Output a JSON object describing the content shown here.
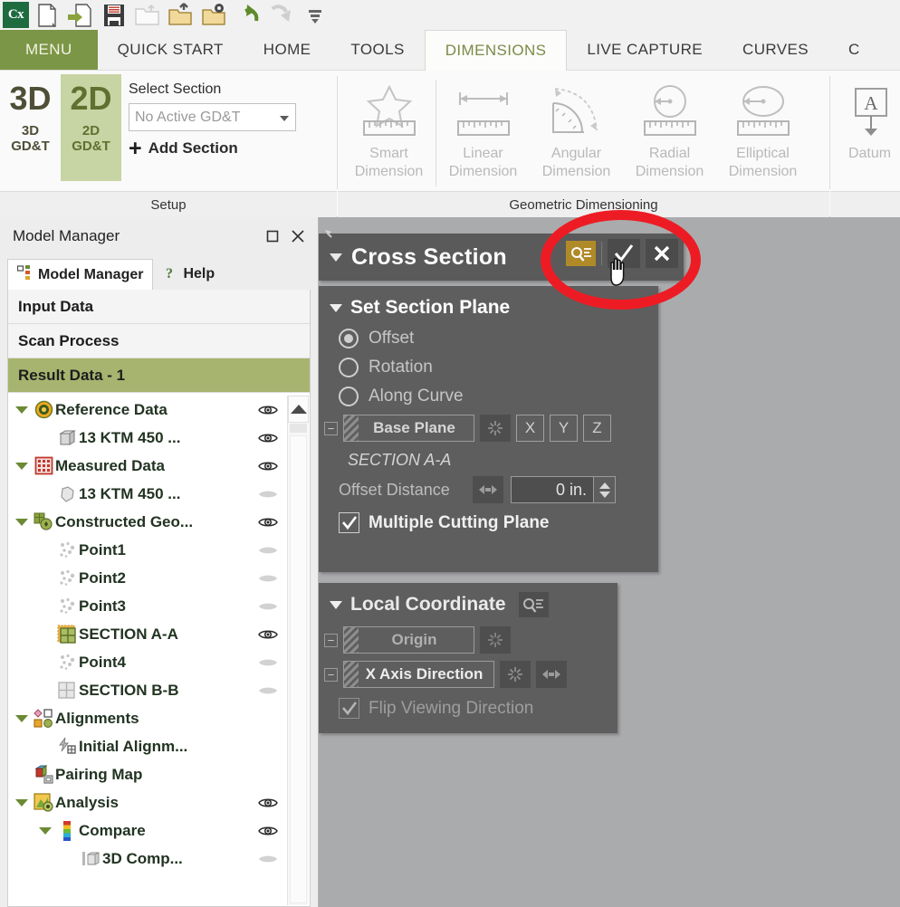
{
  "app": {
    "logo_text": "Cx",
    "quick_access": [
      {
        "name": "new-document-icon",
        "label": "New"
      },
      {
        "name": "import-document-icon",
        "label": "Import"
      },
      {
        "name": "save-icon",
        "label": "Save"
      },
      {
        "name": "open-folder-disabled-icon",
        "label": "Open"
      },
      {
        "name": "open-folder-up-icon",
        "label": "Open Recent"
      },
      {
        "name": "open-folder-settings-icon",
        "label": "Open Settings"
      },
      {
        "name": "undo-icon",
        "label": "Undo"
      },
      {
        "name": "redo-disabled-icon",
        "label": "Redo"
      },
      {
        "name": "customize-toolbar-icon",
        "label": "Customize Quick Access Toolbar"
      }
    ]
  },
  "ribbon": {
    "tabs": [
      {
        "label": "MENU",
        "state": "menu"
      },
      {
        "label": "QUICK START",
        "state": "normal"
      },
      {
        "label": "HOME",
        "state": "normal"
      },
      {
        "label": "TOOLS",
        "state": "normal"
      },
      {
        "label": "DIMENSIONS",
        "state": "active"
      },
      {
        "label": "LIVE CAPTURE",
        "state": "normal"
      },
      {
        "label": "CURVES",
        "state": "normal"
      },
      {
        "label": "C",
        "state": "clipped"
      }
    ],
    "groups": [
      {
        "label": "Setup",
        "big_buttons": [
          {
            "big": "3D",
            "sub_line1": "3D",
            "sub_line2": "GD&T",
            "selected": false
          },
          {
            "big": "2D",
            "sub_line1": "2D",
            "sub_line2": "GD&T",
            "selected": true
          }
        ],
        "select_section_label": "Select Section",
        "select_section_value": "No Active GD&T",
        "add_section_label": "Add Section",
        "add_section_plus": "+"
      },
      {
        "label": "Geometric Dimensioning",
        "buttons": [
          {
            "icon": "smart-dimension-icon",
            "line1": "Smart",
            "line2": "Dimension",
            "disabled": true
          },
          {
            "icon": "linear-dimension-icon",
            "line1": "Linear",
            "line2": "Dimension",
            "disabled": true
          },
          {
            "icon": "angular-dimension-icon",
            "line1": "Angular",
            "line2": "Dimension",
            "disabled": true
          },
          {
            "icon": "radial-dimension-icon",
            "line1": "Radial",
            "line2": "Dimension",
            "disabled": true
          },
          {
            "icon": "elliptical-dimension-icon",
            "line1": "Elliptical",
            "line2": "Dimension",
            "disabled": true
          }
        ]
      },
      {
        "label": "",
        "buttons": [
          {
            "icon": "datum-icon",
            "line1": "Datum",
            "line2": "",
            "disabled": true
          }
        ]
      }
    ]
  },
  "model_manager": {
    "title": "Model Manager",
    "restore_glyph": "□",
    "close_glyph": "✕",
    "tabs": [
      {
        "label": "Model Manager",
        "icon": "tree-icon",
        "active": true
      },
      {
        "label": "Help",
        "icon": "help-icon",
        "active": false
      }
    ],
    "sections": [
      {
        "label": "Input Data",
        "selected": false
      },
      {
        "label": "Scan Process",
        "selected": false
      },
      {
        "label": "Result Data - 1",
        "selected": true
      }
    ],
    "tree": [
      {
        "label": "Reference Data",
        "indent": 0,
        "expander": "down",
        "icon": "reference-data-icon",
        "eye": "visible"
      },
      {
        "label": "13 KTM 450 ...",
        "indent": 1,
        "expander": "none",
        "icon": "cad-mesh-icon",
        "eye": "visible"
      },
      {
        "label": "Measured Data",
        "indent": 0,
        "expander": "down",
        "icon": "measured-data-icon",
        "eye": "visible"
      },
      {
        "label": "13 KTM 450 ...",
        "indent": 1,
        "expander": "none",
        "icon": "scan-mesh-icon",
        "eye": "hidden"
      },
      {
        "label": "Constructed Geo...",
        "indent": 0,
        "expander": "down",
        "icon": "constructed-geo-icon",
        "eye": "visible"
      },
      {
        "label": "Point1",
        "indent": 1,
        "expander": "none",
        "icon": "point-icon",
        "eye": "hidden"
      },
      {
        "label": "Point2",
        "indent": 1,
        "expander": "none",
        "icon": "point-icon",
        "eye": "hidden"
      },
      {
        "label": "Point3",
        "indent": 1,
        "expander": "none",
        "icon": "point-icon",
        "eye": "hidden"
      },
      {
        "label": "SECTION A-A",
        "indent": 1,
        "expander": "none",
        "icon": "section-active-icon",
        "eye": "visible"
      },
      {
        "label": "Point4",
        "indent": 1,
        "expander": "none",
        "icon": "point-icon",
        "eye": "hidden"
      },
      {
        "label": "SECTION B-B",
        "indent": 1,
        "expander": "none",
        "icon": "section-icon",
        "eye": "hidden"
      },
      {
        "label": "Alignments",
        "indent": 0,
        "expander": "down",
        "icon": "alignments-icon",
        "eye": "none"
      },
      {
        "label": "Initial Alignm...",
        "indent": 1,
        "expander": "none",
        "icon": "initial-alignment-icon",
        "eye": "none"
      },
      {
        "label": "Pairing Map",
        "indent": 0,
        "expander": "none",
        "icon": "pairing-map-icon",
        "eye": "none"
      },
      {
        "label": "Analysis",
        "indent": 0,
        "expander": "down",
        "icon": "analysis-icon",
        "eye": "visible"
      },
      {
        "label": "Compare",
        "indent": 1,
        "expander": "down",
        "icon": "compare-icon",
        "eye": "visible"
      },
      {
        "label": "3D Comp...",
        "indent": 2,
        "expander": "none",
        "icon": "compare-3d-icon",
        "eye": "hidden"
      }
    ]
  },
  "cross_section_dialog": {
    "title": "Cross Section",
    "header_buttons": [
      {
        "name": "select-filter-button",
        "glyph": "search-list-icon"
      },
      {
        "name": "ok-button",
        "glyph": "check-icon"
      },
      {
        "name": "close-button",
        "glyph": "close-icon"
      }
    ],
    "set_section_plane": {
      "title": "Set Section Plane",
      "modes": [
        {
          "label": "Offset",
          "selected": true
        },
        {
          "label": "Rotation",
          "selected": false
        },
        {
          "label": "Along Curve",
          "selected": false
        }
      ],
      "base_plane_label": "Base Plane",
      "axis_buttons": [
        "X",
        "Y",
        "Z"
      ],
      "section_name": "SECTION A-A",
      "offset_distance_label": "Offset Distance",
      "offset_distance_value": "0 in.",
      "multiple_cutting_plane": {
        "label": "Multiple Cutting Plane",
        "checked": true
      }
    },
    "local_coordinate": {
      "title": "Local Coordinate",
      "origin_label": "Origin",
      "x_axis_label": "X Axis Direction",
      "flip_viewing": {
        "label": "Flip Viewing Direction",
        "checked": true
      }
    }
  },
  "annotation": {
    "shape": "ellipse",
    "color": "#ed1c24"
  },
  "colors": {
    "accent_green": "#7b9646",
    "selected_row": "#a7b46f",
    "panel_dark": "#5e5e5e",
    "panel_header": "#5a5a5a",
    "viewport": "#aaabad",
    "gold": "#b08a28",
    "annotation_red": "#ed1c24"
  }
}
